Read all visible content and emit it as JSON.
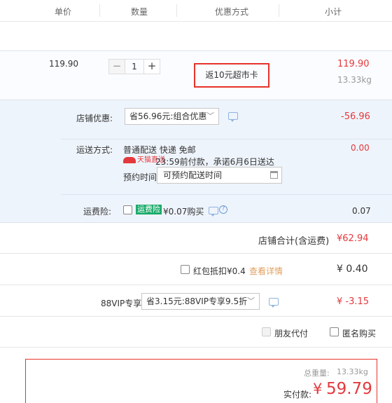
{
  "header": {
    "col_price": "单价",
    "col_qty": "数量",
    "col_promo": "优惠方式",
    "col_subtotal": "小计"
  },
  "item": {
    "unit_price": "119.90",
    "quantity": "1",
    "promo": "返10元超市卡",
    "subtotal": "119.90",
    "weight": "13.33kg"
  },
  "shop": {
    "discount_label": "店铺优惠:",
    "discount_selected": "省56.96元:组合优惠",
    "discount_amount": "-56.96",
    "shipping_label": "运送方式:",
    "shipping_method": "普通配送 快递 免邮",
    "tmall_badge": "天猫直送",
    "shipping_promise": "23:59前付款，承诺6月6日送达",
    "schedule_label": "预约时间",
    "schedule_value": "可预约配送时间",
    "shipping_fee": "0.00",
    "insurance_label": "运费险:",
    "insurance_badge": "运费险",
    "insurance_price": "¥0.07购买",
    "insurance_fee": "0.07",
    "total_label": "店铺合计(含运费)",
    "total_value": "¥62.94"
  },
  "redpacket": {
    "label": "红包抵扣¥0.4",
    "link": "查看详情",
    "value": "¥ 0.40"
  },
  "vip": {
    "label": "88VIP专享",
    "selected": "省3.15元:88VIP专享9.5折",
    "value": "¥ -3.15"
  },
  "options": {
    "friend_pay": "朋友代付",
    "anonymous": "匿名购买"
  },
  "summary": {
    "weight_label": "总重量:",
    "weight_value": "13.33kg",
    "pay_label": "实付款:",
    "currency": "¥",
    "pay_value": "59.79"
  },
  "colors": {
    "accent_red": "#e4393c",
    "panel_bg": "#eef4fb",
    "badge_green": "#1aab6a"
  }
}
